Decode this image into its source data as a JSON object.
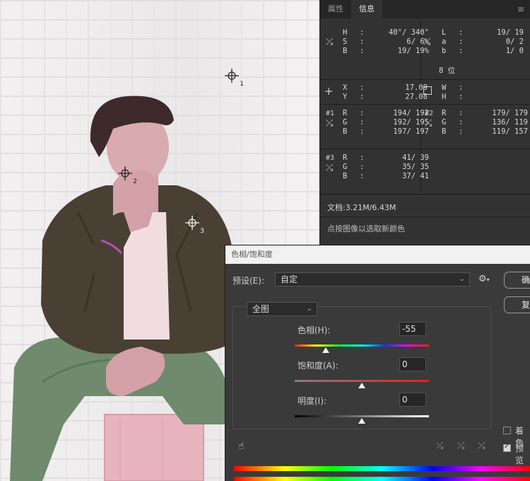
{
  "info_panel": {
    "tabs": [
      {
        "label": "属性"
      },
      {
        "label": "信息"
      }
    ],
    "hsb": {
      "labels": [
        "H",
        "S",
        "B"
      ],
      "values": [
        "40°/ 340°",
        "6/  6%",
        "19/ 19%"
      ]
    },
    "lab": {
      "labels": [
        "L",
        "a",
        "b"
      ],
      "values": [
        "19/ 19",
        "0/  2",
        "1/  0"
      ]
    },
    "bit_depth": "8 位",
    "xy": {
      "labels": [
        "X",
        "Y"
      ],
      "values": [
        "17.09",
        "27.08"
      ]
    },
    "wh": {
      "labels": [
        "W",
        "H"
      ]
    },
    "samplers": [
      {
        "tag": "#1",
        "labels": [
          "R",
          "G",
          "B"
        ],
        "values": [
          "194/ 192",
          "192/ 195",
          "197/ 197"
        ]
      },
      {
        "tag": "#2",
        "labels": [
          "R",
          "G",
          "B"
        ],
        "values": [
          "179/ 179",
          "136/ 119",
          "119/ 157"
        ]
      },
      {
        "tag": "#3",
        "labels": [
          "R",
          "G",
          "B"
        ],
        "values": [
          "41/  39",
          "35/  35",
          "37/  41"
        ]
      }
    ],
    "doc_size": "文档:3.21M/6.43M",
    "hint": "点按图像以选取新颜色"
  },
  "canvas": {
    "sampler_labels": [
      "1",
      "2",
      "3"
    ]
  },
  "dialog": {
    "title": "色相/饱和度",
    "preset_label": "预设(E):",
    "preset_value": "自定",
    "ok_label": "确",
    "reset_label": "复",
    "channel": "全图",
    "hue_label": "色相(H):",
    "hue_value": "-55",
    "hue_fraction": 0.23,
    "saturation_label": "饱和度(A):",
    "saturation_value": "0",
    "saturation_fraction": 0.5,
    "lightness_label": "明度(I):",
    "lightness_value": "0",
    "lightness_fraction": 0.5,
    "colorize_label": "着色",
    "colorize_checked": false,
    "preview_label": "预览",
    "preview_checked": true
  }
}
